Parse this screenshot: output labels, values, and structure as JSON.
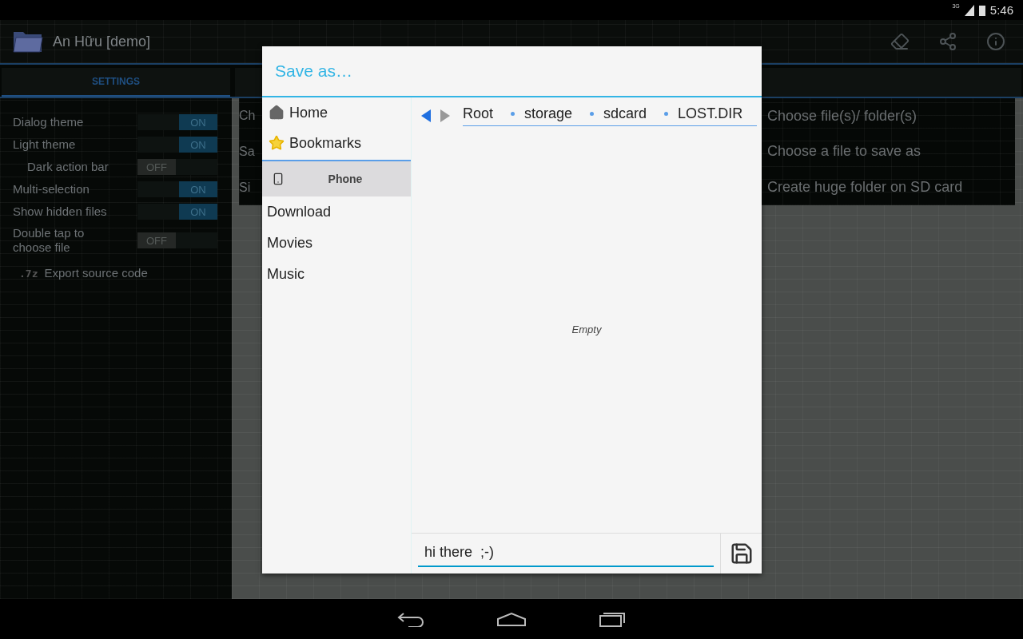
{
  "status_bar": {
    "network": "3G",
    "time": "5:46"
  },
  "action_bar": {
    "title": "An Hữu [demo]"
  },
  "tabs": [
    {
      "label": "SETTINGS",
      "selected": true
    }
  ],
  "settings": [
    {
      "label": "Dialog theme",
      "on": true,
      "state_label": "ON"
    },
    {
      "label": "Light theme",
      "on": true,
      "state_label": "ON",
      "children": [
        {
          "label": "Dark action bar",
          "on": false,
          "state_label": "OFF"
        }
      ]
    },
    {
      "label": "Multi-selection",
      "on": true,
      "state_label": "ON"
    },
    {
      "label": "Show hidden files",
      "on": true,
      "state_label": "ON"
    },
    {
      "label": "Double tap to choose file",
      "on": false,
      "state_label": "OFF"
    }
  ],
  "export": {
    "badge": ".7z",
    "label": "Export source code"
  },
  "actions": {
    "left": [
      "Ch",
      "Sa",
      "Si"
    ],
    "right": [
      "Choose file(s)/ folder(s)",
      "Choose a file to save as",
      "Create huge folder on SD card"
    ]
  },
  "dialog": {
    "title": "Save as…",
    "places": [
      {
        "kind": "home",
        "label": "Home"
      },
      {
        "kind": "bookmarks",
        "label": "Bookmarks"
      }
    ],
    "storage": {
      "label": "Phone",
      "selected": true
    },
    "folders": [
      "Download",
      "Movies",
      "Music"
    ],
    "breadcrumbs": [
      "Root",
      "storage",
      "sdcard",
      "LOST.DIR"
    ],
    "empty_text": "Empty",
    "filename": {
      "value": "hi there  ;-)"
    }
  }
}
